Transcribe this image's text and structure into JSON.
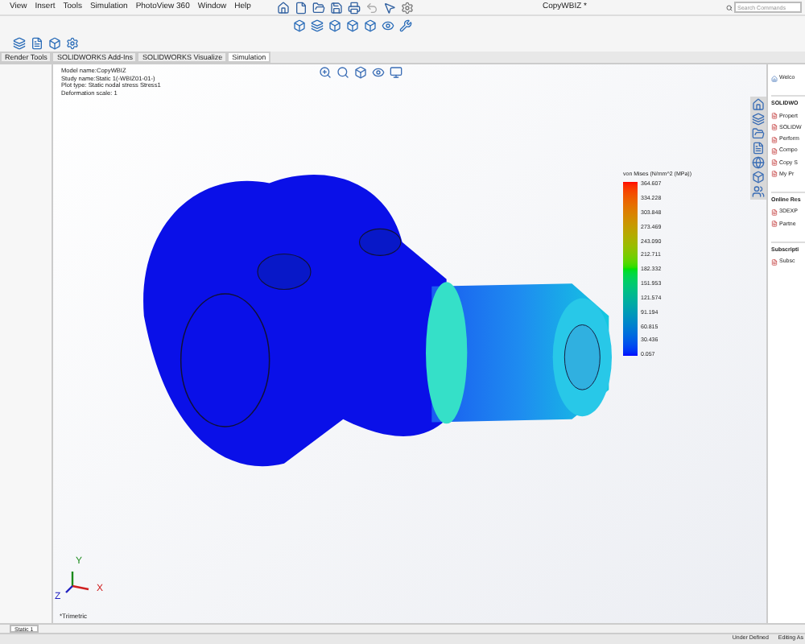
{
  "menu": [
    "View",
    "Insert",
    "Tools",
    "Simulation",
    "PhotoView 360",
    "Window",
    "Help"
  ],
  "window": {
    "title": "CopyWBIZ *"
  },
  "search": {
    "placeholder": "Search Commands"
  },
  "tabs": [
    {
      "label": "Render Tools",
      "selected": false
    },
    {
      "label": "SOLIDWORKS Add-Ins",
      "selected": false
    },
    {
      "label": "SOLIDWORKS Visualize",
      "selected": false
    },
    {
      "label": "Simulation",
      "selected": true
    }
  ],
  "plot_info": [
    "Model name:CopyWBIZ",
    "Study name:Static 1(-WBIZ01-01-)",
    "Plot type: Static nodal stress Stress1",
    "Deformation scale: 1"
  ],
  "legend": {
    "title": "von Mises (N/mm^2 (MPa))",
    "values": [
      "364.607",
      "334.228",
      "303.848",
      "273.469",
      "243.090",
      "212.711",
      "182.332",
      "151.953",
      "121.574",
      "91.194",
      "60.815",
      "30.436",
      "0.057"
    ]
  },
  "axes": [
    "Y",
    "X",
    "Z"
  ],
  "view_label": "*Trimetric",
  "study_tabs": [
    {
      "label": "Static 1",
      "selected": true
    }
  ],
  "task_pane": {
    "welcome": "Welco",
    "sections": [
      {
        "title": "SOLIDWO",
        "items": [
          "Propert",
          "SOLIDW",
          "Perform",
          "Compo",
          "Copy S",
          "My Pr"
        ]
      },
      {
        "title": "Online Res",
        "items": [
          "3DEXP",
          "Partne"
        ]
      },
      {
        "title": "Subscripti",
        "items": [
          "Subsc"
        ]
      }
    ]
  },
  "status_bar": [
    "Under Defined",
    "Editing As"
  ]
}
